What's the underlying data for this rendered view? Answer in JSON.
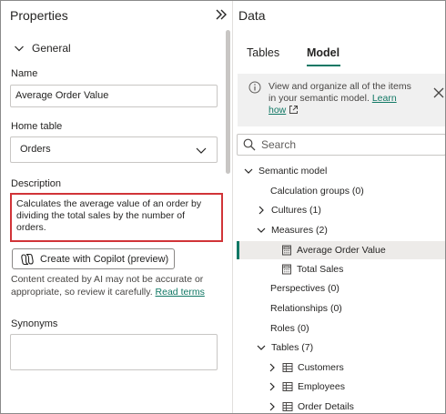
{
  "properties": {
    "title": "Properties",
    "section": "General",
    "name_label": "Name",
    "name_value": "Average Order Value",
    "home_table_label": "Home table",
    "home_table_value": "Orders",
    "description_label": "Description",
    "description_value": "Calculates the average value of an order by dividing the total sales by the number of orders.",
    "copilot_button": "Create with Copilot (preview)",
    "ai_note": "Content created by AI may not be accurate or appropriate, so review it carefully.",
    "ai_note_link": "Read terms",
    "synonyms_label": "Synonyms"
  },
  "data_pane": {
    "title": "Data",
    "tabs": [
      {
        "label": "Tables",
        "selected": false
      },
      {
        "label": "Model",
        "selected": true
      }
    ],
    "info_text": "View and organize all of the items in your semantic model.",
    "info_link": "Learn how",
    "search_placeholder": "Search",
    "tree": {
      "root": "Semantic model",
      "calculation_groups": "Calculation groups (0)",
      "cultures": "Cultures (1)",
      "measures": "Measures (2)",
      "measure_items": [
        "Average Order Value",
        "Total Sales"
      ],
      "perspectives": "Perspectives (0)",
      "relationships": "Relationships (0)",
      "roles": "Roles (0)",
      "tables": "Tables (7)",
      "table_items": [
        "Customers",
        "Employees",
        "Order Details"
      ]
    }
  },
  "colors": {
    "accent": "#117865",
    "highlight_border": "#d13438",
    "selected_row": "#edebe9"
  }
}
